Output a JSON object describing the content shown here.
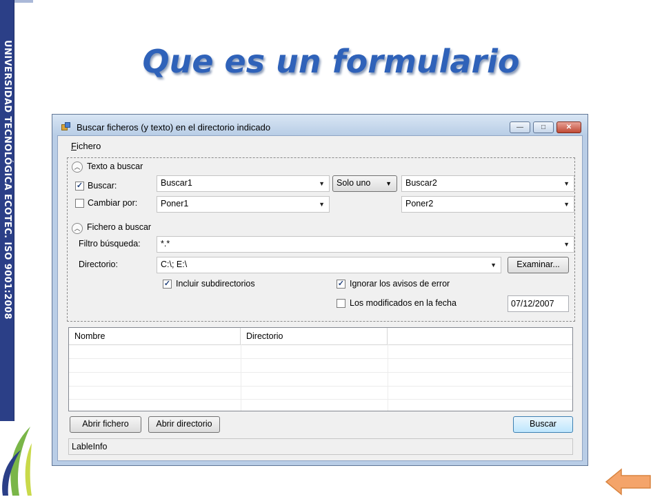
{
  "slide": {
    "title": "Que es un formulario",
    "sidebar_text": "UNIVERSIDAD TECNOLÓGICA ECOTEC. ISO 9001:2008"
  },
  "window": {
    "title": "Buscar ficheros (y texto) en el directorio indicado",
    "controls": {
      "minimize": "—",
      "maximize": "□",
      "close": "✕"
    },
    "menu": {
      "fichero_accel": "F",
      "fichero_rest": "ichero"
    },
    "section_texto": {
      "title": "Texto a buscar",
      "buscar_label": "Buscar:",
      "buscar_checked": true,
      "buscar1_value": "Buscar1",
      "mode_value": "Solo uno",
      "buscar2_value": "Buscar2",
      "cambiar_label": "Cambiar por:",
      "cambiar_checked": false,
      "poner1_value": "Poner1",
      "poner2_value": "Poner2"
    },
    "section_fichero": {
      "title": "Fichero a buscar",
      "filtro_label": "Filtro búsqueda:",
      "filtro_value": "*.*",
      "directorio_label": "Directorio:",
      "directorio_value": "C:\\; E:\\",
      "examinar_label": "Examinar...",
      "subdirs_label": "Incluir subdirectorios",
      "subdirs_checked": true,
      "ignorar_label": "Ignorar los avisos de error",
      "ignorar_checked": true,
      "modificados_label": "Los modificados en la fecha",
      "modificados_checked": false,
      "fecha_value": "07/12/2007"
    },
    "results": {
      "columns": [
        "Nombre",
        "Directorio",
        ""
      ]
    },
    "buttons": {
      "abrir_fichero": "Abrir fichero",
      "abrir_directorio": "Abrir directorio",
      "buscar": "Buscar"
    },
    "status": "LableInfo"
  },
  "icons": {
    "collapse": "chevron-up-icon",
    "dropdown": "dropdown-arrow-icon",
    "check": "checkmark-icon",
    "back": "left-arrow-icon"
  },
  "colors": {
    "title": "#2f62b9",
    "sidebar": "#2b3f87",
    "window_frame": "#b9cde6",
    "arrow": "#f4a46a"
  }
}
